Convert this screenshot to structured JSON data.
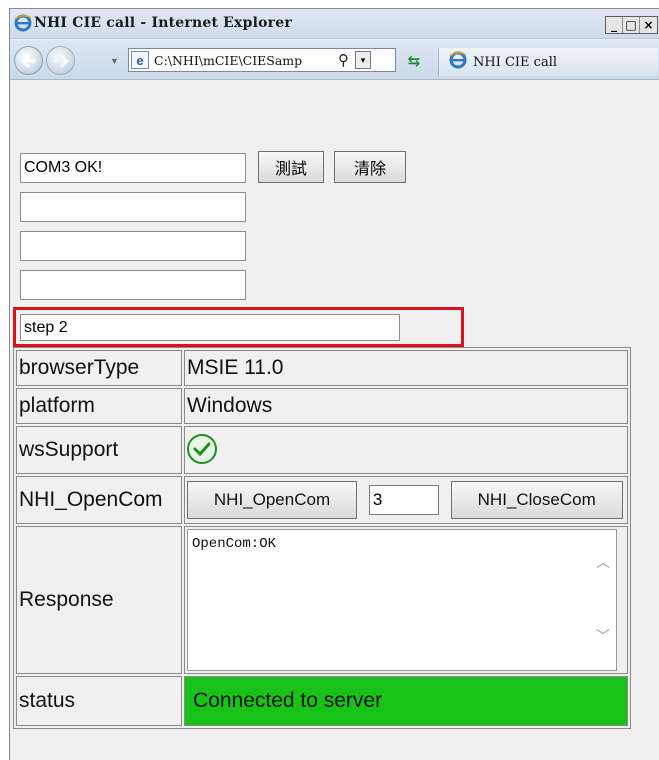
{
  "window": {
    "title": "NHI CIE call - Internet Explorer",
    "controls": [
      "_",
      "□",
      "×"
    ]
  },
  "navbar": {
    "address": "C:\\NHI\\mCIE\\CIESamp",
    "search_icon": "search-icon",
    "dropdown_arrow": "▾",
    "tab_title": "NHI CIE call"
  },
  "form": {
    "com_status_value": "COM3 OK!",
    "test_button": "測試",
    "clear_button": "清除",
    "field2_value": "",
    "field3_value": "",
    "field4_value": "",
    "step_value": "step 2"
  },
  "table": {
    "rows": [
      {
        "label": "browserType",
        "value": "MSIE 11.0"
      },
      {
        "label": "platform",
        "value": "Windows"
      },
      {
        "label": "wsSupport",
        "value_icon": "check-circle-icon"
      },
      {
        "label": "NHI_OpenCom"
      },
      {
        "label": "Response"
      },
      {
        "label": "status",
        "value": "Connected to server"
      }
    ],
    "open_com_button": "NHI_OpenCom",
    "com_port_value": "3",
    "close_com_button": "NHI_CloseCom",
    "response_text": "OpenCom:OK",
    "status_color": "#16c316"
  },
  "colors": {
    "highlight_border": "#d9141a",
    "ok_icon": "#1e8f1e"
  }
}
